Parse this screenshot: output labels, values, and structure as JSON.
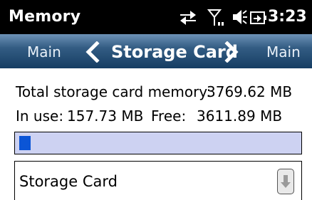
{
  "statusbar": {
    "app_title": "Memory",
    "time": "3:23",
    "icons": [
      "sync-arrows-icon",
      "signal-icon",
      "speaker-icon",
      "battery-plug-icon"
    ]
  },
  "navbar": {
    "left_label": "Main",
    "center_label": "Storage Card",
    "right_label": "Main"
  },
  "memory": {
    "total_label": "Total storage card memory:",
    "total_value": "3769.62 MB",
    "in_use_label": "In use:",
    "in_use_value": "157.73 MB",
    "free_label": "Free:",
    "free_value": "3611.89 MB",
    "usage_fraction": 0.042
  },
  "selector": {
    "selected": "Storage Card"
  },
  "colors": {
    "navbar": "#335c83",
    "bar_track": "#cdd2f2",
    "bar_fill": "#0b55d6"
  }
}
